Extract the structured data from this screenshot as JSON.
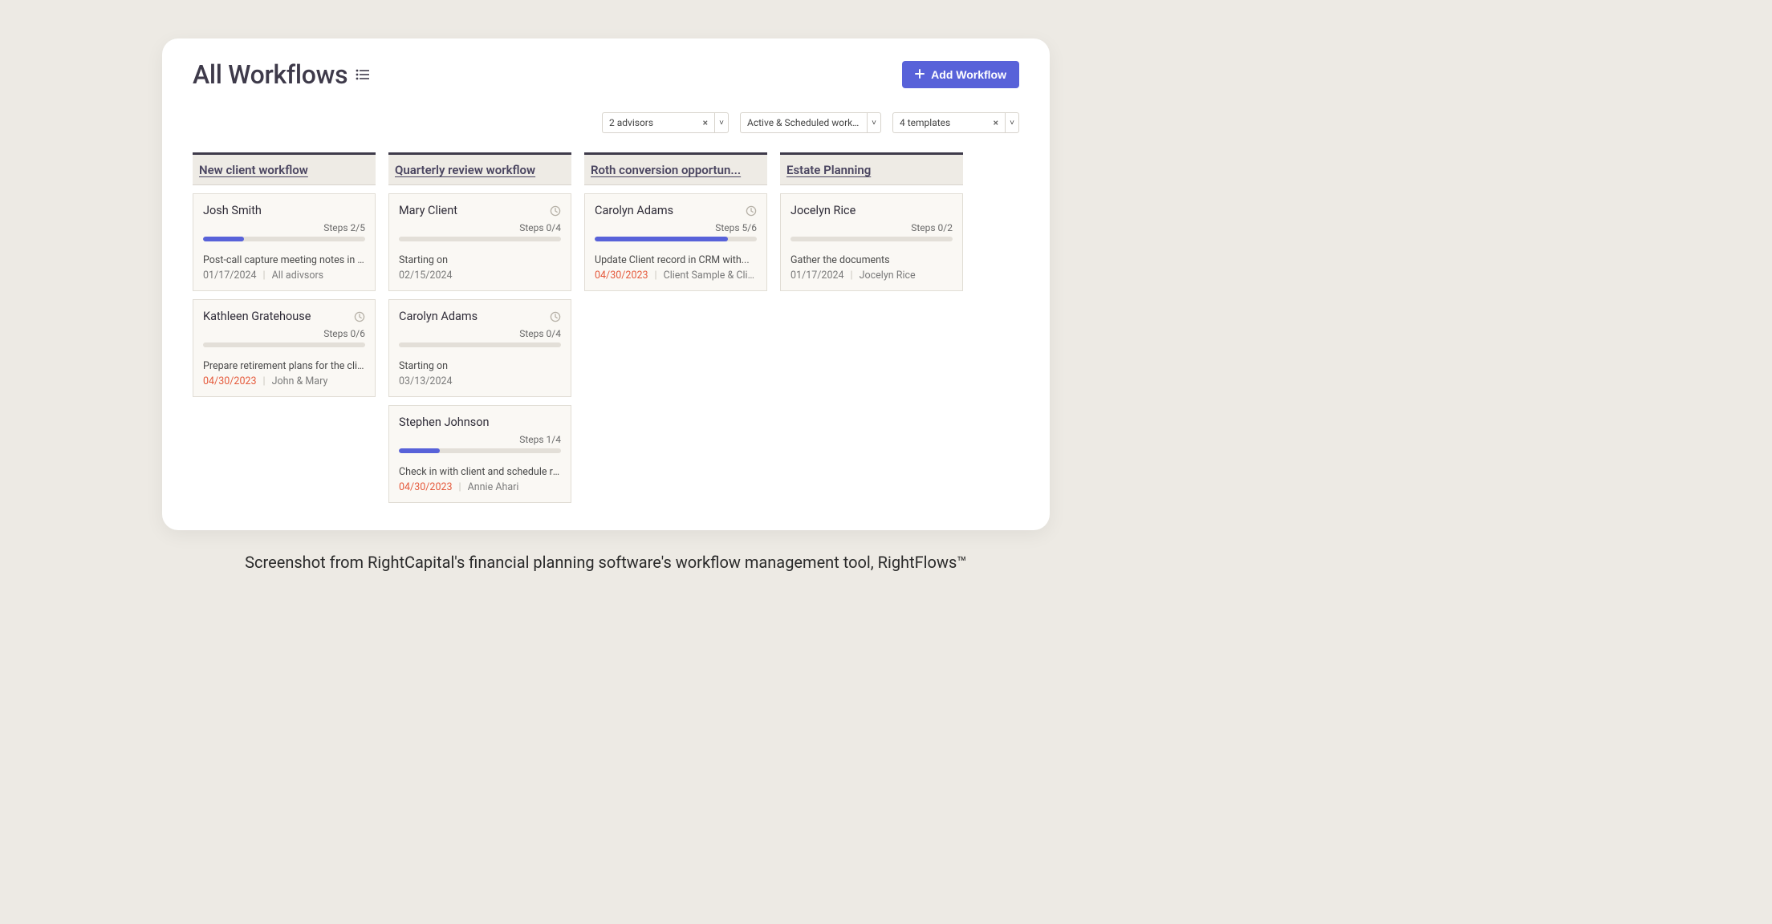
{
  "page": {
    "title": "All Workflows",
    "add_button_label": "Add Workflow"
  },
  "filters": {
    "advisors": {
      "label": "2 advisors",
      "clearable": true
    },
    "status": {
      "label": "Active & Scheduled workfl...",
      "clearable": false
    },
    "templates": {
      "label": "4 templates",
      "clearable": true
    }
  },
  "columns": [
    {
      "title": "New client workflow",
      "cards": [
        {
          "name": "Josh Smith",
          "has_clock": false,
          "steps_label": "Steps 2/5",
          "progress_pct": 25,
          "desc": "Post-call capture meeting notes in ...",
          "date": "01/17/2024",
          "date_overdue": false,
          "assignees": "All adivsors"
        },
        {
          "name": "Kathleen Gratehouse",
          "has_clock": true,
          "steps_label": "Steps 0/6",
          "progress_pct": 0,
          "desc": "Prepare retirement plans for the clie...",
          "date": "04/30/2023",
          "date_overdue": true,
          "assignees": "John & Mary"
        }
      ]
    },
    {
      "title": "Quarterly review workflow",
      "cards": [
        {
          "name": "Mary Client",
          "has_clock": true,
          "steps_label": "Steps 0/4",
          "progress_pct": 0,
          "desc": "Starting on",
          "date": "02/15/2024",
          "date_overdue": false,
          "assignees": ""
        },
        {
          "name": "Carolyn Adams",
          "has_clock": true,
          "steps_label": "Steps 0/4",
          "progress_pct": 0,
          "desc": "Starting on",
          "date": "03/13/2024",
          "date_overdue": false,
          "assignees": ""
        },
        {
          "name": "Stephen Johnson",
          "has_clock": false,
          "steps_label": "Steps 1/4",
          "progress_pct": 25,
          "desc": "Check in with client and schedule re...",
          "date": "04/30/2023",
          "date_overdue": true,
          "assignees": "Annie Ahari"
        }
      ]
    },
    {
      "title": "Roth conversion opportun...",
      "cards": [
        {
          "name": "Carolyn Adams",
          "has_clock": true,
          "steps_label": "Steps 5/6",
          "progress_pct": 82,
          "desc": "Update Client record in CRM with...",
          "date": "04/30/2023",
          "date_overdue": true,
          "assignees": "Client Sample & Clien..."
        }
      ]
    },
    {
      "title": "Estate Planning",
      "cards": [
        {
          "name": "Jocelyn Rice",
          "has_clock": false,
          "steps_label": "Steps 0/2",
          "progress_pct": 0,
          "desc": "Gather the documents",
          "date": "01/17/2024",
          "date_overdue": false,
          "assignees": "Jocelyn Rice"
        }
      ]
    }
  ],
  "caption": "Screenshot from RightCapital's financial planning software's workflow management tool, RightFlows™"
}
